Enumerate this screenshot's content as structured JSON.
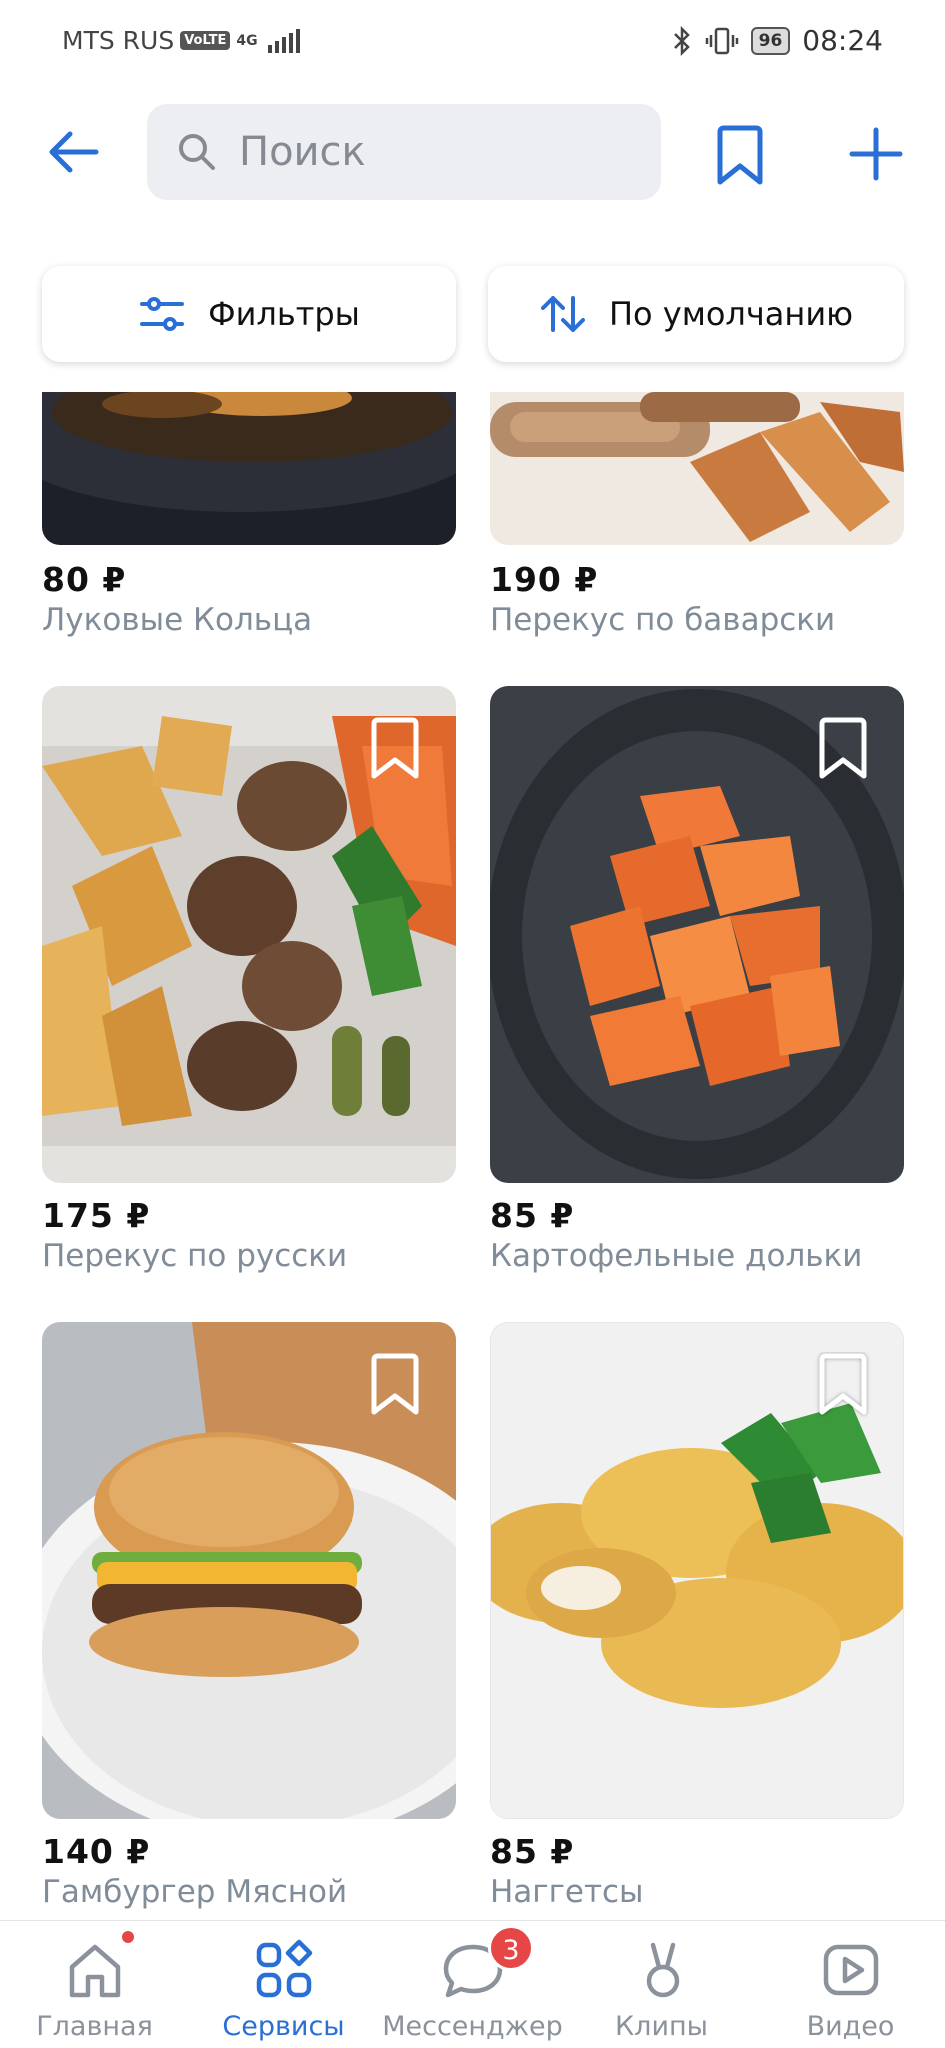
{
  "status_bar": {
    "carrier": "MTS RUS",
    "volte": "VoLTE",
    "network": "4G",
    "battery": "96",
    "time": "08:24"
  },
  "header": {
    "search_placeholder": "Поиск"
  },
  "filters": {
    "filters_label": "Фильтры",
    "sort_label": "По умолчанию"
  },
  "products": [
    {
      "price": "80 ₽",
      "title": "Луковые Кольца"
    },
    {
      "price": "190 ₽",
      "title": "Перекус по баварски"
    },
    {
      "price": "175 ₽",
      "title": "Перекус по русски"
    },
    {
      "price": "85 ₽",
      "title": "Картофельные дольки"
    },
    {
      "price": "140 ₽",
      "title": "Гамбургер Мясной"
    },
    {
      "price": "85 ₽",
      "title": "Наггетсы"
    }
  ],
  "bottom_nav": {
    "tabs": [
      {
        "label": "Главная",
        "icon": "home-icon"
      },
      {
        "label": "Сервисы",
        "icon": "services-icon"
      },
      {
        "label": "Мессенджер",
        "icon": "messenger-icon",
        "badge": "3"
      },
      {
        "label": "Клипы",
        "icon": "clips-icon"
      },
      {
        "label": "Видео",
        "icon": "video-icon"
      }
    ]
  },
  "colors": {
    "accent": "#2a6fd6",
    "price_text": "#111111",
    "title_text": "#818c99",
    "badge": "#e64646"
  }
}
